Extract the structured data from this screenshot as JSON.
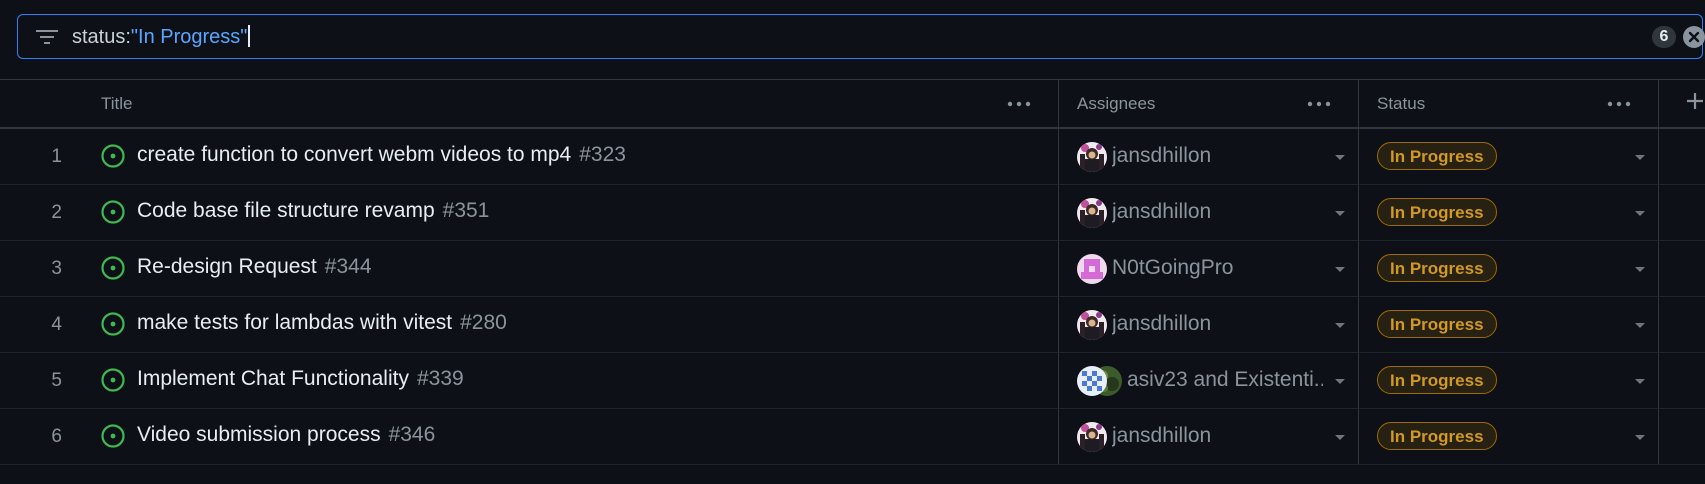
{
  "filter": {
    "key": "status:",
    "value": "\"In Progress\"",
    "count": "6"
  },
  "columns": {
    "title": "Title",
    "assignees": "Assignees",
    "status": "Status"
  },
  "rows": [
    {
      "num": "1",
      "title": "create function to convert webm videos to mp4",
      "issue": "#323",
      "assignee": "jansdhillon",
      "status": "In Progress"
    },
    {
      "num": "2",
      "title": "Code base file structure revamp",
      "issue": "#351",
      "assignee": "jansdhillon",
      "status": "In Progress"
    },
    {
      "num": "3",
      "title": "Re-design Request",
      "issue": "#344",
      "assignee": "N0tGoingPro",
      "status": "In Progress"
    },
    {
      "num": "4",
      "title": "make tests for lambdas with vitest",
      "issue": "#280",
      "assignee": "jansdhillon",
      "status": "In Progress"
    },
    {
      "num": "5",
      "title": "Implement Chat Functionality",
      "issue": "#339",
      "assignee": "asiv23 and Existenti...",
      "status": "In Progress"
    },
    {
      "num": "6",
      "title": "Video submission process",
      "issue": "#346",
      "assignee": "jansdhillon",
      "status": "In Progress"
    }
  ],
  "colors": {
    "accent": "#2f81f7",
    "open_issue": "#3fb950",
    "status_in_progress": "#d29922"
  }
}
